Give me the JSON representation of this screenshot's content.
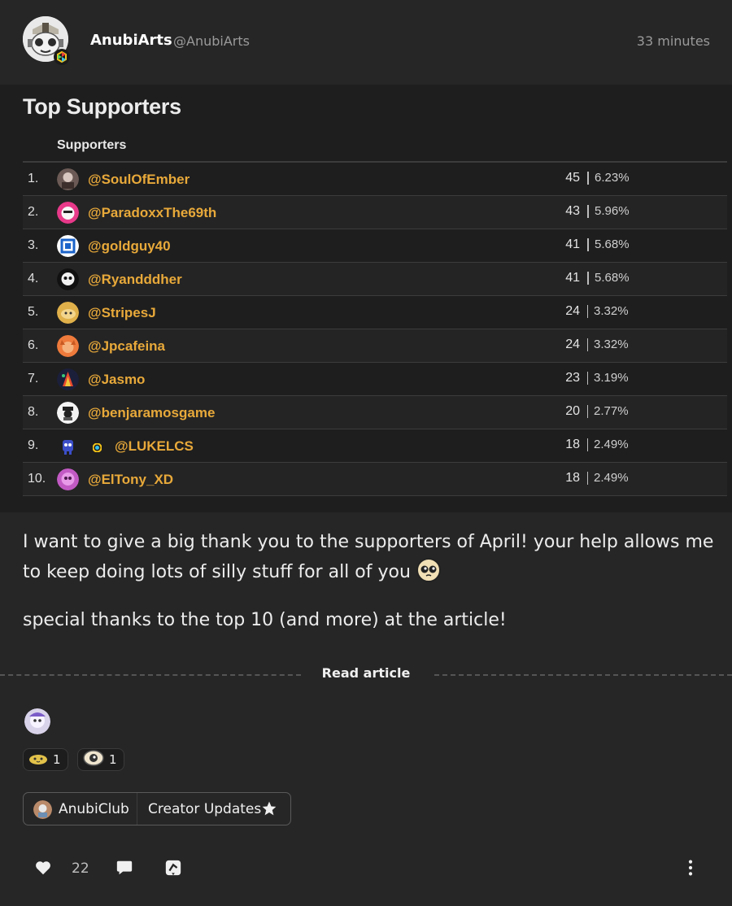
{
  "author": {
    "name": "AnubiArts",
    "handle": "@AnubiArts",
    "time": "33 minutes"
  },
  "image": {
    "title": "Top Supporters",
    "column_header": "Supporters",
    "rows": [
      {
        "rank": "1.",
        "name": "@SoulOfEmber",
        "count": "45",
        "percent": "6.23%"
      },
      {
        "rank": "2.",
        "name": "@ParadoxxThe69th",
        "count": "43",
        "percent": "5.96%"
      },
      {
        "rank": "3.",
        "name": "@goldguy40",
        "count": "41",
        "percent": "5.68%"
      },
      {
        "rank": "4.",
        "name": "@Ryandddher",
        "count": "41",
        "percent": "5.68%"
      },
      {
        "rank": "5.",
        "name": "@StripesJ",
        "count": "24",
        "percent": "3.32%"
      },
      {
        "rank": "6.",
        "name": "@Jpcafeina",
        "count": "24",
        "percent": "3.32%"
      },
      {
        "rank": "7.",
        "name": "@Jasmo",
        "count": "23",
        "percent": "3.19%"
      },
      {
        "rank": "8.",
        "name": "@benjaramosgame",
        "count": "20",
        "percent": "2.77%"
      },
      {
        "rank": "9.",
        "name": "@LUKELCS",
        "count": "18",
        "percent": "2.49%"
      },
      {
        "rank": "10.",
        "name": "@ElTony_XD",
        "count": "18",
        "percent": "2.49%"
      }
    ]
  },
  "post": {
    "paragraph1": "I want to give a big thank you to the supporters of April! your help allows me to keep doing lots of silly stuff for all of you",
    "paragraph2": "special thanks to the top 10 (and more) at the article!",
    "read_article": "Read article"
  },
  "reactions": [
    {
      "icon": "blob-emoji-icon",
      "count": "1"
    },
    {
      "icon": "eye-emoji-icon",
      "count": "1"
    }
  ],
  "tags": {
    "club": "AnubiClub",
    "collection": "Creator Updates"
  },
  "actions": {
    "like_count": "22"
  },
  "colors": {
    "background": "#262626",
    "image_background": "#1e1e1e",
    "supporter_name": "#e8a93a"
  }
}
